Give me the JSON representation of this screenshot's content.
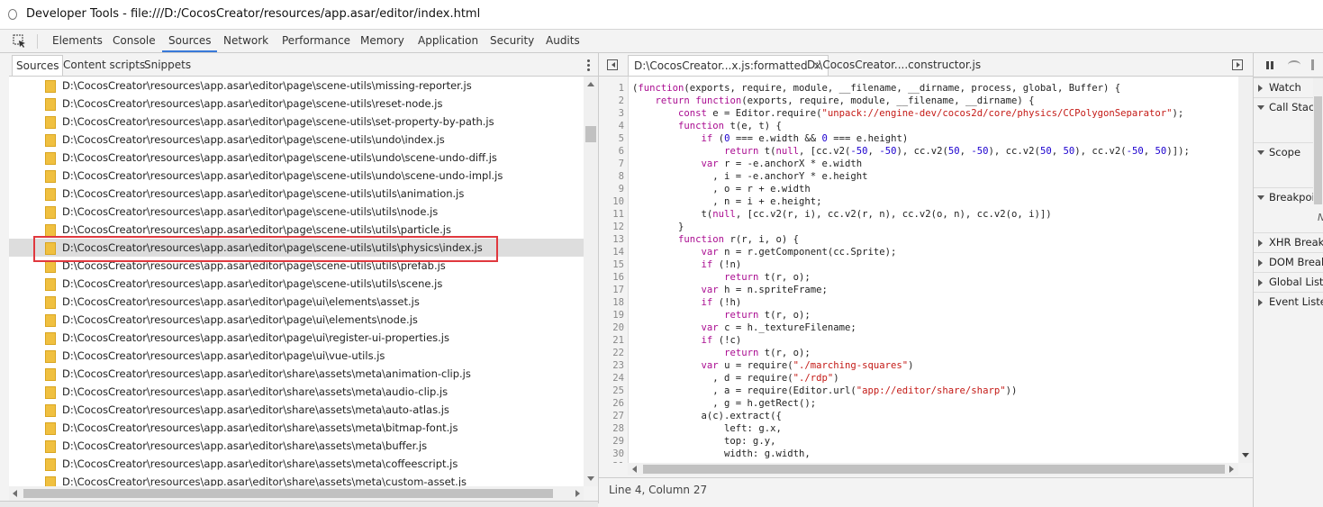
{
  "window": {
    "title": "Developer Tools - file:///D:/CocosCreator/resources/app.asar/editor/index.html"
  },
  "main_tabs": [
    {
      "label": "Elements"
    },
    {
      "label": "Console"
    },
    {
      "label": "Sources"
    },
    {
      "label": "Network"
    },
    {
      "label": "Performance"
    },
    {
      "label": "Memory"
    },
    {
      "label": "Application"
    },
    {
      "label": "Security"
    },
    {
      "label": "Audits"
    }
  ],
  "sub_tabs": [
    {
      "label": "Sources"
    },
    {
      "label": "Content scripts"
    },
    {
      "label": "Snippets"
    }
  ],
  "files": [
    "D:\\CocosCreator\\resources\\app.asar\\editor\\page\\scene-utils\\missing-reporter.js",
    "D:\\CocosCreator\\resources\\app.asar\\editor\\page\\scene-utils\\reset-node.js",
    "D:\\CocosCreator\\resources\\app.asar\\editor\\page\\scene-utils\\set-property-by-path.js",
    "D:\\CocosCreator\\resources\\app.asar\\editor\\page\\scene-utils\\undo\\index.js",
    "D:\\CocosCreator\\resources\\app.asar\\editor\\page\\scene-utils\\undo\\scene-undo-diff.js",
    "D:\\CocosCreator\\resources\\app.asar\\editor\\page\\scene-utils\\undo\\scene-undo-impl.js",
    "D:\\CocosCreator\\resources\\app.asar\\editor\\page\\scene-utils\\utils\\animation.js",
    "D:\\CocosCreator\\resources\\app.asar\\editor\\page\\scene-utils\\utils\\node.js",
    "D:\\CocosCreator\\resources\\app.asar\\editor\\page\\scene-utils\\utils\\particle.js",
    "D:\\CocosCreator\\resources\\app.asar\\editor\\page\\scene-utils\\utils\\physics\\index.js",
    "D:\\CocosCreator\\resources\\app.asar\\editor\\page\\scene-utils\\utils\\prefab.js",
    "D:\\CocosCreator\\resources\\app.asar\\editor\\page\\scene-utils\\utils\\scene.js",
    "D:\\CocosCreator\\resources\\app.asar\\editor\\page\\ui\\elements\\asset.js",
    "D:\\CocosCreator\\resources\\app.asar\\editor\\page\\ui\\elements\\node.js",
    "D:\\CocosCreator\\resources\\app.asar\\editor\\page\\ui\\register-ui-properties.js",
    "D:\\CocosCreator\\resources\\app.asar\\editor\\page\\ui\\vue-utils.js",
    "D:\\CocosCreator\\resources\\app.asar\\editor\\share\\assets\\meta\\animation-clip.js",
    "D:\\CocosCreator\\resources\\app.asar\\editor\\share\\assets\\meta\\audio-clip.js",
    "D:\\CocosCreator\\resources\\app.asar\\editor\\share\\assets\\meta\\auto-atlas.js",
    "D:\\CocosCreator\\resources\\app.asar\\editor\\share\\assets\\meta\\bitmap-font.js",
    "D:\\CocosCreator\\resources\\app.asar\\editor\\share\\assets\\meta\\buffer.js",
    "D:\\CocosCreator\\resources\\app.asar\\editor\\share\\assets\\meta\\coffeescript.js",
    "D:\\CocosCreator\\resources\\app.asar\\editor\\share\\assets\\meta\\custom-asset.js"
  ],
  "editor_tabs": [
    {
      "label": "D:\\CocosCreator...x.js:formatted",
      "close": "×"
    },
    {
      "label": "D:\\CocosCreator....constructor.js"
    }
  ],
  "code": [
    "(function(exports, require, module, __filename, __dirname, process, global, Buffer) {",
    "    return function(exports, require, module, __filename, __dirname) {",
    "        const e = Editor.require(\"unpack://engine-dev/cocos2d/core/physics/CCPolygonSeparator\");",
    "        function t(e, t) {",
    "            if (0 === e.width && 0 === e.height)",
    "                return t(null, [cc.v2(-50, -50), cc.v2(50, -50), cc.v2(50, 50), cc.v2(-50, 50)]);",
    "            var r = -e.anchorX * e.width",
    "              , i = -e.anchorY * e.height",
    "              , o = r + e.width",
    "              , n = i + e.height;",
    "            t(null, [cc.v2(r, i), cc.v2(r, n), cc.v2(o, n), cc.v2(o, i)])",
    "        }",
    "        function r(r, i, o) {",
    "            var n = r.getComponent(cc.Sprite);",
    "            if (!n)",
    "                return t(r, o);",
    "            var h = n.spriteFrame;",
    "            if (!h)",
    "                return t(r, o);",
    "            var c = h._textureFilename;",
    "            if (!c)",
    "                return t(r, o);",
    "            var u = require(\"./marching-squares\")",
    "              , d = require(\"./rdp\")",
    "              , a = require(Editor.url(\"app://editor/share/sharp\"))",
    "              , g = h.getRect();",
    "            a(c).extract({",
    "                left: g.x,",
    "                top: g.y,",
    "                width: g.width,",
    ""
  ],
  "status": {
    "position": "Line 4, Column 27"
  },
  "debugger": {
    "sections": [
      "Watch",
      "Call Stack",
      "Scope",
      "Breakpoints",
      "XHR Breakpoints",
      "DOM Breakpoints",
      "Global Listeners",
      "Event Listeners"
    ],
    "breakpoints_hint": "N"
  }
}
